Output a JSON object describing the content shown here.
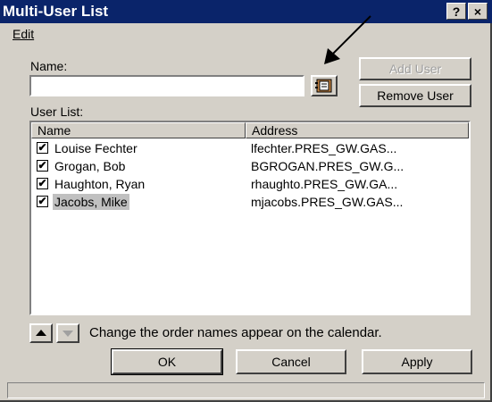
{
  "window": {
    "title": "Multi-User List",
    "help_glyph": "?",
    "close_glyph": "×"
  },
  "menu": {
    "edit_label": "Edit"
  },
  "name_field": {
    "label": "Name:",
    "value": ""
  },
  "buttons": {
    "add_user": "Add User",
    "remove_user": "Remove User",
    "ok": "OK",
    "cancel": "Cancel",
    "apply": "Apply"
  },
  "user_list": {
    "label": "User List:",
    "columns": [
      "Name",
      "Address"
    ],
    "rows": [
      {
        "name": "Louise Fechter",
        "address": "lfechter.PRES_GW.GAS...",
        "checked": true,
        "selected": false
      },
      {
        "name": "Grogan, Bob",
        "address": "BGROGAN.PRES_GW.G...",
        "checked": true,
        "selected": false
      },
      {
        "name": "Haughton, Ryan",
        "address": "rhaughto.PRES_GW.GA...",
        "checked": true,
        "selected": false
      },
      {
        "name": "Jacobs, Mike",
        "address": "mjacobs.PRES_GW.GAS...",
        "checked": true,
        "selected": true
      }
    ]
  },
  "order_hint": "Change the order names appear on the calendar.",
  "icons": {
    "address_book": "address-book-icon",
    "move_up": "arrow-up-icon",
    "move_down": "arrow-down-icon",
    "annotation": "annotation-arrow"
  },
  "colors": {
    "titlebar": "#0a246a",
    "face": "#d4d0c8",
    "selection": "#c0c0c0"
  }
}
